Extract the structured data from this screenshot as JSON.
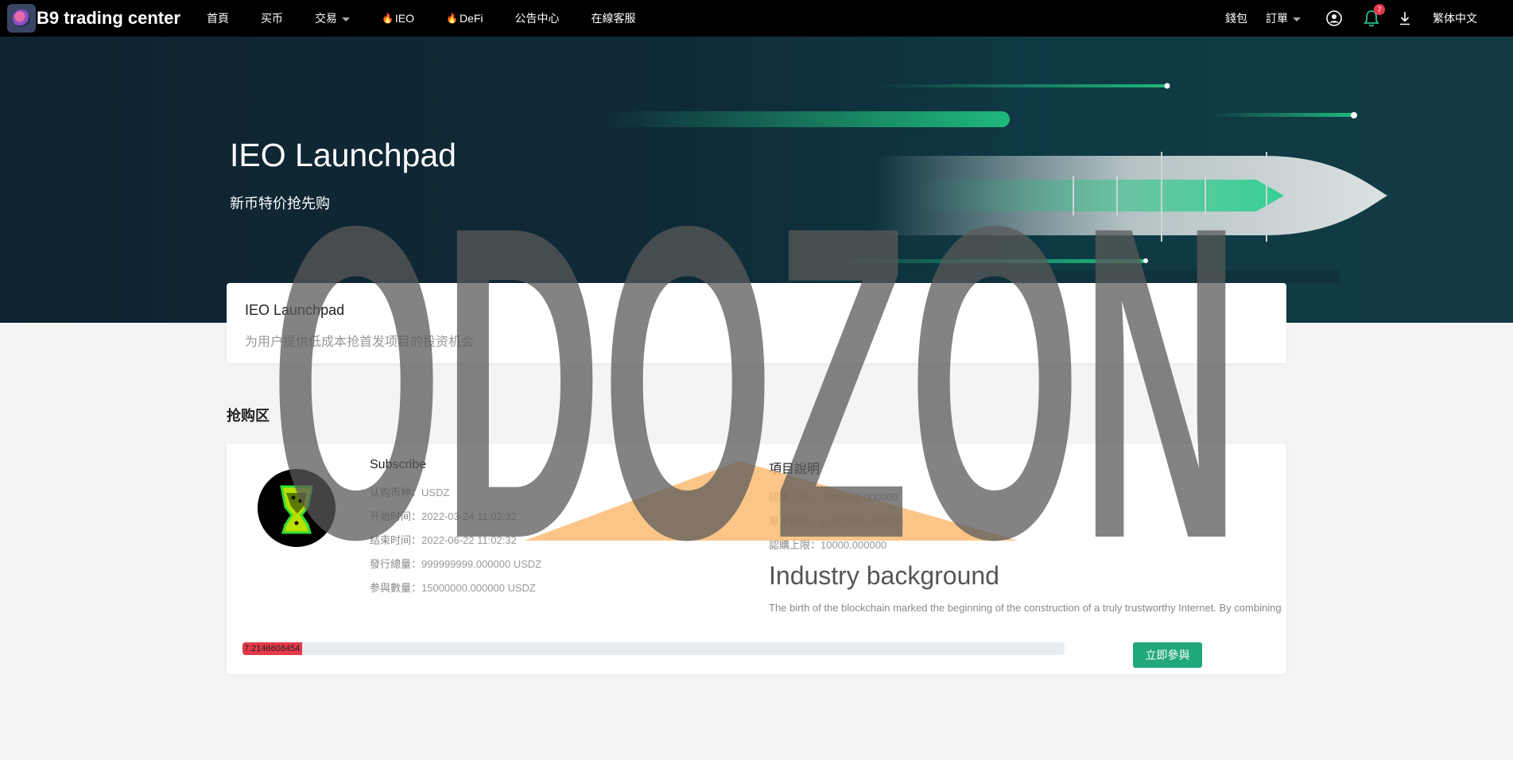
{
  "brand": {
    "name": "B9 trading center"
  },
  "nav": {
    "items": [
      {
        "label": "首頁"
      },
      {
        "label": "买币"
      },
      {
        "label": "交易"
      },
      {
        "label": "IEO"
      },
      {
        "label": "DeFi"
      },
      {
        "label": "公告中心"
      },
      {
        "label": "在線客服"
      }
    ],
    "right": {
      "wallet": "錢包",
      "orders": "訂單",
      "notification_count": "7",
      "language": "繁体中文"
    }
  },
  "hero": {
    "title": "IEO Launchpad",
    "subtitle": "新币特价抢先购"
  },
  "intro": {
    "title": "IEO Launchpad",
    "description": "为用户提供低成本抢首发项目的投资机会"
  },
  "section": {
    "title": "抢购区"
  },
  "project": {
    "heading": "Subscribe",
    "rows": [
      {
        "label": "认购币种：",
        "value": "USDZ"
      },
      {
        "label": "开始时间：",
        "value": "2022-03-24 11:02:32"
      },
      {
        "label": "结束时间：",
        "value": "2022-06-22 11:02:32"
      },
      {
        "label": "發行總量：",
        "value": "999999999.000000 USDZ"
      },
      {
        "label": "参與數量：",
        "value": "15000000.000000 USDZ"
      }
    ],
    "details_heading": "項目說明",
    "details": [
      {
        "label": "認購上限：",
        "value": "9999999.000000"
      },
      {
        "label": "單次最低：",
        "value": "15000000.000000"
      },
      {
        "label": "認購上限：",
        "value": "10000.000000"
      }
    ],
    "background_title": "Industry background",
    "background_text": "The birth of the blockchain marked the beginning of the construction of a truly trustworthy Internet. By combining",
    "progress_text": "7.2146608454",
    "progress_percent": 7.2146608454,
    "join_label": "立即參與"
  },
  "watermark": {
    "text": "ODOZON"
  },
  "colors": {
    "accent_green": "#21a87a",
    "progress_red": "#e6394c",
    "hero_bg": "#0f2330"
  }
}
